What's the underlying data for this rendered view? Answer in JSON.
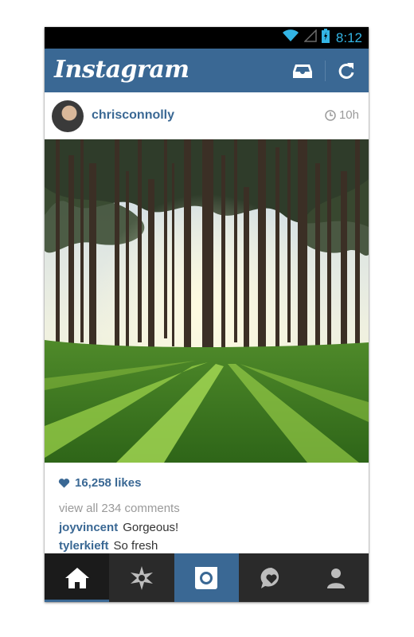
{
  "status_bar": {
    "time": "8:12",
    "accent": "#33b5e5"
  },
  "app": {
    "title": "Instagram",
    "brand_color": "#3a6894"
  },
  "action_bar": {
    "inbox_icon": "inbox-icon",
    "refresh_icon": "refresh-icon"
  },
  "post": {
    "username": "chrisconnolly",
    "time_ago": "10h",
    "likes": "16,258 likes",
    "view_comments": "view all 234 comments",
    "comments": [
      {
        "user": "joyvincent",
        "text": "Gorgeous!"
      },
      {
        "user": "tylerkieft",
        "text": "So fresh"
      }
    ]
  },
  "bottom_nav": {
    "tabs": [
      {
        "name": "home",
        "icon": "home-icon",
        "selected": true
      },
      {
        "name": "explore",
        "icon": "star-icon"
      },
      {
        "name": "camera",
        "icon": "camera-icon"
      },
      {
        "name": "news",
        "icon": "activity-icon"
      },
      {
        "name": "profile",
        "icon": "person-icon"
      }
    ]
  }
}
